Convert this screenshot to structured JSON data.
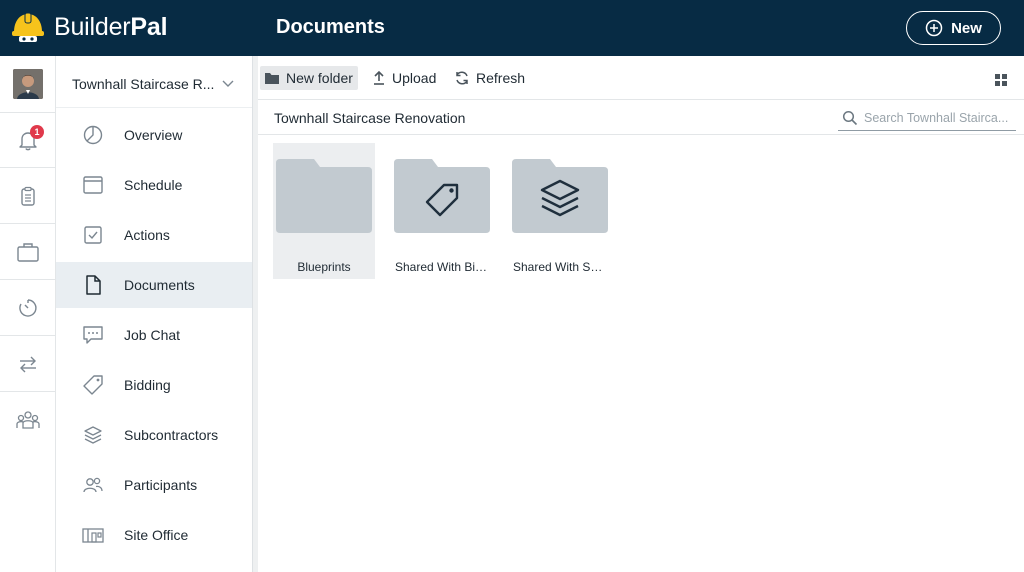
{
  "app": {
    "brand_light": "Builder",
    "brand_bold": "Pal",
    "page_title": "Documents",
    "new_button_label": "New"
  },
  "project": {
    "name": "Townhall Staircase R..."
  },
  "rail": {
    "notification_count": "1",
    "items": [
      "bell-icon",
      "clipboard-icon",
      "briefcase-icon",
      "timer-icon",
      "transfer-icon",
      "team-icon"
    ]
  },
  "nav": {
    "items": [
      {
        "label": "Overview",
        "icon": "pie-chart-icon"
      },
      {
        "label": "Schedule",
        "icon": "calendar-icon"
      },
      {
        "label": "Actions",
        "icon": "checkbox-icon"
      },
      {
        "label": "Documents",
        "icon": "document-icon",
        "active": true
      },
      {
        "label": "Job Chat",
        "icon": "chat-icon"
      },
      {
        "label": "Bidding",
        "icon": "tag-icon"
      },
      {
        "label": "Subcontractors",
        "icon": "layers-icon"
      },
      {
        "label": "Participants",
        "icon": "people-icon"
      },
      {
        "label": "Site Office",
        "icon": "site-office-icon"
      }
    ]
  },
  "toolbar": {
    "new_folder_label": "New folder",
    "upload_label": "Upload",
    "refresh_label": "Refresh"
  },
  "breadcrumb": "Townhall Staircase Renovation",
  "search": {
    "placeholder": "Search Townhall Stairca...",
    "value": ""
  },
  "folders": [
    {
      "name": "Blueprints",
      "icon": "folder-icon",
      "selected": true
    },
    {
      "name": "Shared With Bid ...",
      "icon": "folder-tag-icon"
    },
    {
      "name": "Shared With Sub...",
      "icon": "folder-layers-icon"
    }
  ],
  "colors": {
    "header_bg": "#072b44",
    "folder_gray": "#c2cad0",
    "badge_red": "#e0394b",
    "active_nav_bg": "#e9eef2",
    "helmet_yellow": "#f6c31c"
  }
}
